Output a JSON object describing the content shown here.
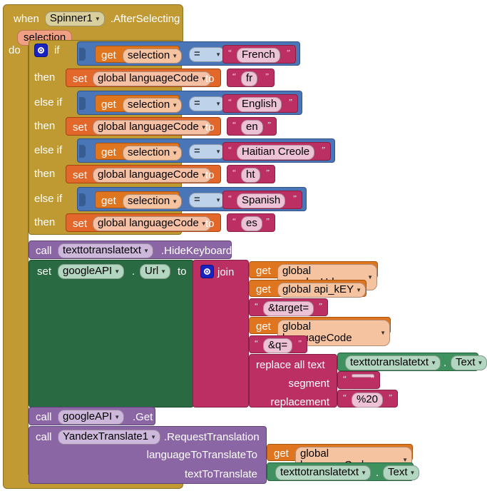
{
  "editor": {
    "name": "MIT App Inventor Blocks Editor",
    "background": "#ffffff"
  },
  "colors": {
    "event_gold": "#c19a33",
    "control_gold": "#bf9a32",
    "variable_orange": "#e0751f",
    "setter_orange": "#e2672a",
    "logic_blue": "#4a76b8",
    "text_magenta": "#bb2f62",
    "component_green": "#2a6a42",
    "component_green_light": "#3f9160",
    "call_purple": "#8a66a5",
    "mutator_blue": "#1823c0"
  },
  "event_block": {
    "when_label": "when",
    "component": "Spinner1",
    "event": ".AfterSelecting",
    "parameter": "selection",
    "do_label": "do"
  },
  "if_block": {
    "gear_icon": "mutator-gear-icon",
    "if_label": "if",
    "then_label": "then",
    "else_if_label": "else if",
    "branches": [
      {
        "kind": "if",
        "condition": {
          "get_label": "get",
          "variable": "selection",
          "operator": "=",
          "compare_text": "French"
        },
        "action": {
          "set_label": "set",
          "variable": "global languageCode",
          "to_label": "to",
          "value_text": "fr"
        }
      },
      {
        "kind": "else if",
        "condition": {
          "get_label": "get",
          "variable": "selection",
          "operator": "=",
          "compare_text": "English"
        },
        "action": {
          "set_label": "set",
          "variable": "global languageCode",
          "to_label": "to",
          "value_text": "en"
        }
      },
      {
        "kind": "else if",
        "condition": {
          "get_label": "get",
          "variable": "selection",
          "operator": "=",
          "compare_text": "Haitian Creole"
        },
        "action": {
          "set_label": "set",
          "variable": "global languageCode",
          "to_label": "to",
          "value_text": "ht"
        }
      },
      {
        "kind": "else if",
        "condition": {
          "get_label": "get",
          "variable": "selection",
          "operator": "=",
          "compare_text": "Spanish"
        },
        "action": {
          "set_label": "set",
          "variable": "global languageCode",
          "to_label": "to",
          "value_text": "es"
        }
      }
    ]
  },
  "hide_keyboard_call": {
    "call_label": "call",
    "component": "texttotranslatetxt",
    "method": ".HideKeyboard"
  },
  "set_url_block": {
    "set_label": "set",
    "component": "googleAPI",
    "dot": ".",
    "property": "Url",
    "to_label": "to"
  },
  "join_block": {
    "gear_icon": "mutator-gear-icon",
    "join_label": "join",
    "items": [
      {
        "type": "get",
        "get_label": "get",
        "variable": "global google_Url"
      },
      {
        "type": "get",
        "get_label": "get",
        "variable": "global api_kEY"
      },
      {
        "type": "text",
        "value": "&target="
      },
      {
        "type": "get",
        "get_label": "get",
        "variable": "global languageCode"
      },
      {
        "type": "text",
        "value": "&q="
      },
      {
        "type": "replace",
        "title": "replace all text",
        "text_component": "texttotranslatetxt",
        "text_property": "Text",
        "segment_label": "segment",
        "segment_value": " ",
        "replacement_label": "replacement",
        "replacement_value": "%20"
      }
    ]
  },
  "get_call": {
    "call_label": "call",
    "component": "googleAPI",
    "method": ".Get"
  },
  "yandex_call": {
    "call_label": "call",
    "component": "YandexTranslate1",
    "method": ".RequestTranslation",
    "args": [
      {
        "label": "languageToTranslateTo",
        "value_type": "get",
        "get_label": "get",
        "variable": "global languageCode"
      },
      {
        "label": "textToTranslate",
        "value_type": "component_get",
        "component": "texttotranslatetxt",
        "dot": ".",
        "property": "Text"
      }
    ]
  }
}
